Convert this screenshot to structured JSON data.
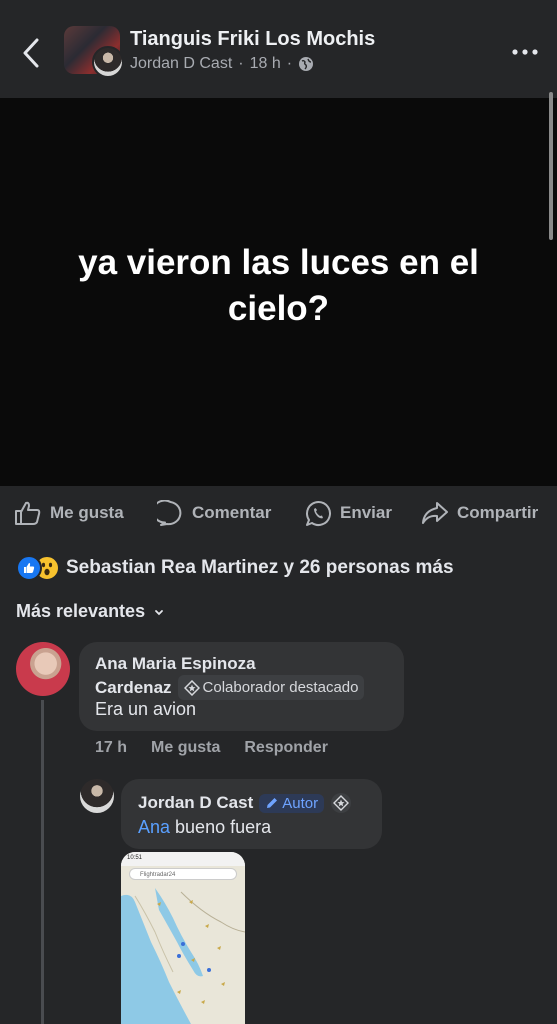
{
  "header": {
    "group_name": "Tianguis Friki Los Mochis",
    "author": "Jordan D Cast",
    "time": "18 h",
    "separator": "·"
  },
  "post": {
    "text_line1": "ya vieron las luces en el",
    "text_line2": "cielo?"
  },
  "actions": {
    "like": "Me gusta",
    "comment": "Comentar",
    "send": "Enviar",
    "share": "Compartir"
  },
  "reactions": {
    "summary": "Sebastian Rea Martinez y 26 personas más"
  },
  "sort": {
    "label": "Más relevantes"
  },
  "comments": [
    {
      "name_line1": "Ana Maria Espinoza",
      "name_line2": "Cardenaz",
      "badge": "Colaborador destacado",
      "text": "Era un avion",
      "time": "17 h",
      "like": "Me gusta",
      "reply": "Responder"
    },
    {
      "name": "Jordan D Cast",
      "badge": "Autor",
      "mention": "Ana",
      "text": " bueno fuera",
      "attachment": {
        "status_time": "10:51",
        "search_text": "Flightradar24"
      }
    }
  ],
  "colors": {
    "background": "#252628",
    "post_background": "#0a0a0a",
    "accent_blue": "#1877f2",
    "mention": "#5aa0ff"
  },
  "icons": [
    "back-arrow-icon",
    "globe-icon",
    "more-dots-icon",
    "thumbs-up-icon",
    "comment-bubble-icon",
    "whatsapp-icon",
    "share-arrow-icon",
    "like-reaction-icon",
    "wow-reaction-icon",
    "chevron-down-icon",
    "pencil-icon",
    "star-badge-icon"
  ]
}
